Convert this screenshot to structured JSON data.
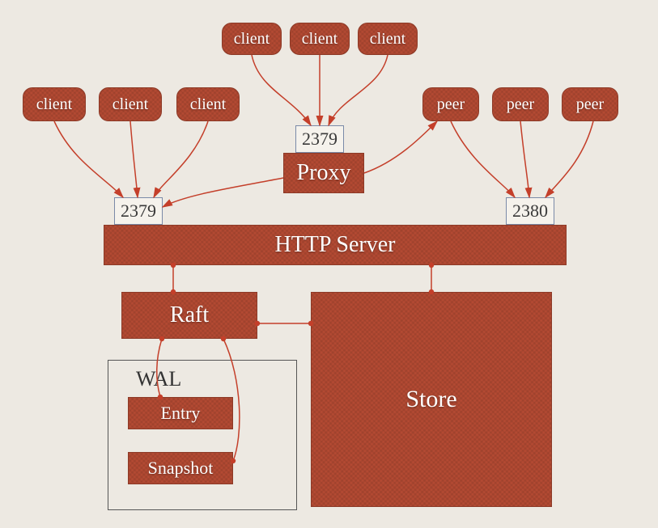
{
  "clients_top": {
    "c1": "client",
    "c2": "client",
    "c3": "client"
  },
  "clients_left": {
    "c1": "client",
    "c2": "client",
    "c3": "client"
  },
  "peers": {
    "p1": "peer",
    "p2": "peer",
    "p3": "peer"
  },
  "ports": {
    "proxy_port": "2379",
    "http_left": "2379",
    "http_right": "2380"
  },
  "labels": {
    "proxy": "Proxy",
    "http_server": "HTTP Server",
    "raft": "Raft",
    "store": "Store",
    "wal": "WAL",
    "entry": "Entry",
    "snapshot": "Snapshot"
  }
}
